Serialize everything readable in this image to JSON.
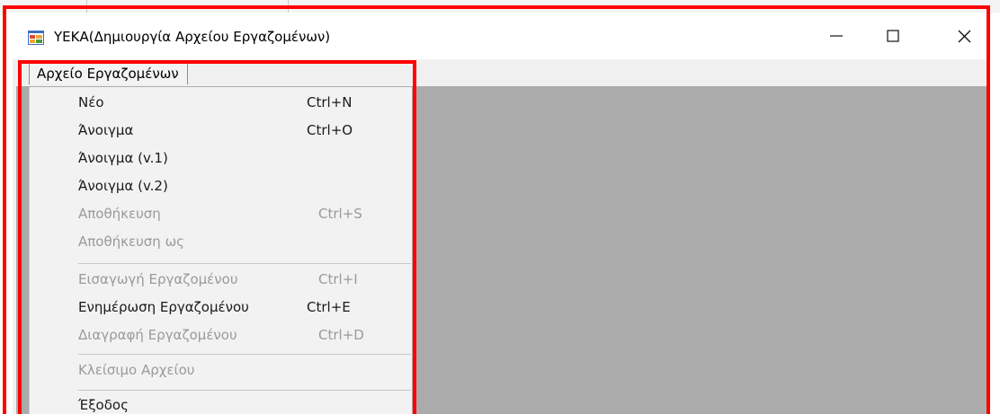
{
  "window": {
    "title": "ΥΕΚΑ(Δημιουργία Αρχείου Εργαζομένων)",
    "app_icon": "app-window-icon",
    "controls": [
      "minimize-icon",
      "maximize-icon",
      "close-icon"
    ]
  },
  "menubar": {
    "open_menu": "Αρχείο Εργαζομένων"
  },
  "menu": {
    "items": [
      {
        "label": "Νέο",
        "shortcut": "Ctrl+N",
        "enabled": true
      },
      {
        "label": "Άνοιγμα",
        "shortcut": "Ctrl+O",
        "enabled": true
      },
      {
        "label": "Άνοιγμα (v.1)",
        "shortcut": "",
        "enabled": true
      },
      {
        "label": "Άνοιγμα (v.2)",
        "shortcut": "",
        "enabled": true
      },
      {
        "label": "Αποθήκευση",
        "shortcut": "Ctrl+S",
        "enabled": false
      },
      {
        "label": "Αποθήκευση ως",
        "shortcut": "",
        "enabled": false
      },
      {
        "label": "Εισαγωγή Εργαζομένου",
        "shortcut": "Ctrl+I",
        "enabled": false
      },
      {
        "label": "Ενημέρωση Εργαζομένου",
        "shortcut": "Ctrl+E",
        "enabled": true
      },
      {
        "label": "Διαγραφή Εργαζομένου",
        "shortcut": "Ctrl+D",
        "enabled": false
      },
      {
        "label": "Κλείσιμο Αρχείου",
        "shortcut": "",
        "enabled": false
      },
      {
        "label": "Έξοδος",
        "shortcut": "",
        "enabled": true
      }
    ]
  },
  "colors": {
    "highlight": "#ff0000",
    "disabled_text": "#9a9a9a",
    "mdi_background": "#ababab",
    "menu_background": "#f2f2f2"
  }
}
